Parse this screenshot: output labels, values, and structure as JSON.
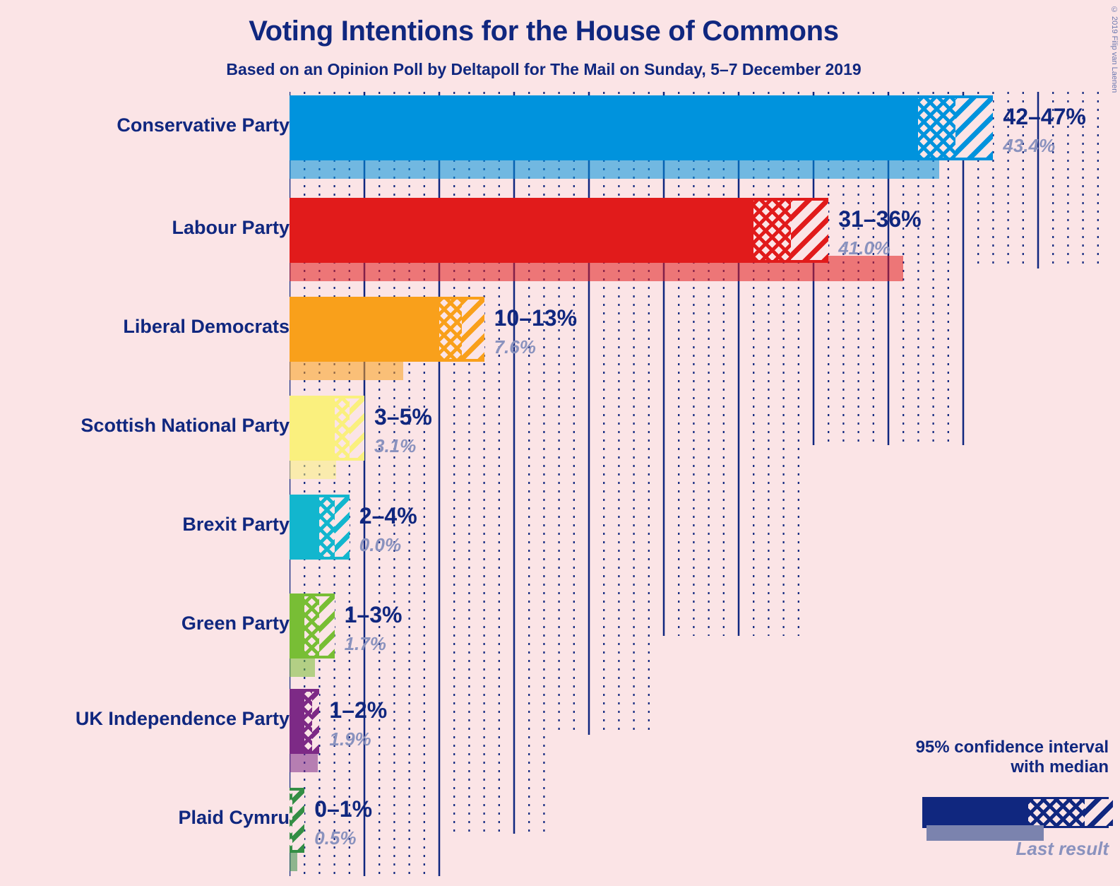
{
  "header": {
    "title": "Voting Intentions for the House of Commons",
    "subtitle": "Based on an Opinion Poll by Deltapoll for The Mail on Sunday, 5–7 December 2019",
    "copyright": "© 2019 Filip van Laenen"
  },
  "legend": {
    "ci_line1": "95% confidence interval",
    "ci_line2": "with median",
    "last_result_label": "Last result"
  },
  "chart_data": {
    "type": "bar",
    "title": "Voting Intentions for the House of Commons",
    "subtitle": "Based on an Opinion Poll by Deltapoll for The Mail on Sunday, 5–7 December 2019",
    "xlabel": "",
    "ylabel": "",
    "orientation": "horizontal",
    "xlim": [
      0,
      55
    ],
    "grid": {
      "major_step": 5,
      "minor_step": 1,
      "visible": true
    },
    "legend_position": "bottom-right",
    "categories": [
      "Conservative Party",
      "Labour Party",
      "Liberal Democrats",
      "Scottish National Party",
      "Brexit Party",
      "Green Party",
      "UK Independence Party",
      "Plaid Cymru"
    ],
    "series": [
      {
        "name": "95% confidence interval with median",
        "points": [
          {
            "category": "Conservative Party",
            "low": 42,
            "median": 44.5,
            "high": 47,
            "range_label": "42–47%"
          },
          {
            "category": "Labour Party",
            "low": 31,
            "median": 33.5,
            "high": 36,
            "range_label": "31–36%"
          },
          {
            "category": "Liberal Democrats",
            "low": 10,
            "median": 11.5,
            "high": 13,
            "range_label": "10–13%"
          },
          {
            "category": "Scottish National Party",
            "low": 3,
            "median": 4.0,
            "high": 5,
            "range_label": "3–5%"
          },
          {
            "category": "Brexit Party",
            "low": 2,
            "median": 3.0,
            "high": 4,
            "range_label": "2–4%"
          },
          {
            "category": "Green Party",
            "low": 1,
            "median": 2.0,
            "high": 3,
            "range_label": "1–3%"
          },
          {
            "category": "UK Independence Party",
            "low": 1,
            "median": 1.5,
            "high": 2,
            "range_label": "1–2%"
          },
          {
            "category": "Plaid Cymru",
            "low": 0,
            "median": 0.2,
            "high": 1,
            "range_label": "0–1%"
          }
        ]
      },
      {
        "name": "Last result",
        "points": [
          {
            "category": "Conservative Party",
            "value": 43.4,
            "label": "43.4%"
          },
          {
            "category": "Labour Party",
            "value": 41.0,
            "label": "41.0%"
          },
          {
            "category": "Liberal Democrats",
            "value": 7.6,
            "label": "7.6%"
          },
          {
            "category": "Scottish National Party",
            "value": 3.1,
            "label": "3.1%"
          },
          {
            "category": "Brexit Party",
            "value": 0.0,
            "label": "0.0%"
          },
          {
            "category": "Green Party",
            "value": 1.7,
            "label": "1.7%"
          },
          {
            "category": "UK Independence Party",
            "value": 1.9,
            "label": "1.9%"
          },
          {
            "category": "Plaid Cymru",
            "value": 0.5,
            "label": "0.5%"
          }
        ]
      }
    ],
    "colors": {
      "Conservative Party": "#0093DD",
      "Labour Party": "#E11B1B",
      "Liberal Democrats": "#F9A01B",
      "Scottish National Party": "#FAF07E",
      "Brexit Party": "#12B6CE",
      "Green Party": "#78BE35",
      "UK Independence Party": "#7D2A86",
      "Plaid Cymru": "#348E45",
      "background": "#FBE4E6",
      "text": "#10277F",
      "last_result": "#8A92BE",
      "grid": "#10277F"
    }
  },
  "rows": [
    {
      "label": "Conservative Party",
      "range": "42–47%",
      "last": "43.4%"
    },
    {
      "label": "Labour Party",
      "range": "31–36%",
      "last": "41.0%"
    },
    {
      "label": "Liberal Democrats",
      "range": "10–13%",
      "last": "7.6%"
    },
    {
      "label": "Scottish National Party",
      "range": "3–5%",
      "last": "3.1%"
    },
    {
      "label": "Brexit Party",
      "range": "2–4%",
      "last": "0.0%"
    },
    {
      "label": "Green Party",
      "range": "1–3%",
      "last": "1.7%"
    },
    {
      "label": "UK Independence Party",
      "range": "1–2%",
      "last": "1.9%"
    },
    {
      "label": "Plaid Cymru",
      "range": "0–1%",
      "last": "0.5%"
    }
  ]
}
